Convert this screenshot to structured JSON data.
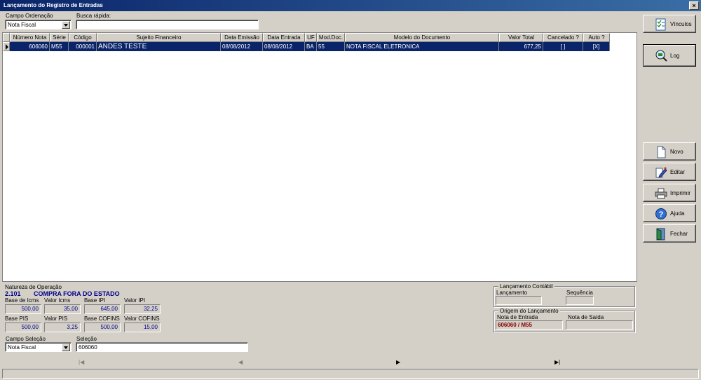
{
  "window": {
    "title": "Lançamento do Registro de Entradas",
    "close": "×"
  },
  "top": {
    "campo_ordenacao_label": "Campo Ordenação",
    "campo_ordenacao_value": "Nota Fiscal",
    "busca_rapida_label": "Busca rápida:",
    "busca_rapida_value": ""
  },
  "grid": {
    "columns": [
      "Número Nota",
      "Série",
      "Código",
      "Sujeito Financeiro",
      "Data Emissão",
      "Data Entrada",
      "UF",
      "Mod.Doc.",
      "Modelo do Documento",
      "Valor Total",
      "Cancelado ?",
      "Auto ?"
    ],
    "rows": [
      [
        "606060",
        "M55",
        "000001",
        "ANDES TESTE",
        "08/08/2012",
        "08/08/2012",
        "BA",
        "55",
        "NOTA FISCAL ELETRONICA",
        "677,25",
        "[ ]",
        "[X]"
      ]
    ]
  },
  "natureza": {
    "label": "Natureza de Operação",
    "code": "2.101",
    "description": "COMPRA FORA DO ESTADO",
    "fields": [
      {
        "label": "Base de Icms",
        "value": "500,00"
      },
      {
        "label": "Valor Icms",
        "value": "35,00"
      },
      {
        "label": "Base IPI",
        "value": "645,00"
      },
      {
        "label": "Valor IPI",
        "value": "32,25"
      },
      {
        "label": "Base PIS",
        "value": "500,00"
      },
      {
        "label": "Valor PIS",
        "value": "3,25"
      },
      {
        "label": "Base COFINS",
        "value": "500,00"
      },
      {
        "label": "Valor COFINS",
        "value": "15,00"
      }
    ]
  },
  "contabil": {
    "title": "Lançamento Contábil",
    "lancamento_label": "Lançamento",
    "lancamento_value": "",
    "sequencia_label": "Sequência",
    "sequencia_value": ""
  },
  "origem": {
    "title": "Origem do Lançamento",
    "nota_entrada_label": "Nota de Entrada",
    "nota_entrada_value": "606060 / M55",
    "nota_saida_label": "Nota de Saída",
    "nota_saida_value": ""
  },
  "selecao": {
    "campo_label": "Campo Seleção",
    "campo_value": "Nota Fiscal",
    "selecao_label": "Seleção",
    "selecao_value": "606060"
  },
  "buttons": {
    "vinculos": "Vínculos",
    "log": "Log",
    "novo": "Novo",
    "editar": "Editar",
    "imprimir": "Imprimir",
    "ajuda": "Ajuda",
    "fechar": "Fechar"
  },
  "nav": {
    "first": "|◀",
    "prev": "◀",
    "next": "▶",
    "last": "▶|"
  }
}
